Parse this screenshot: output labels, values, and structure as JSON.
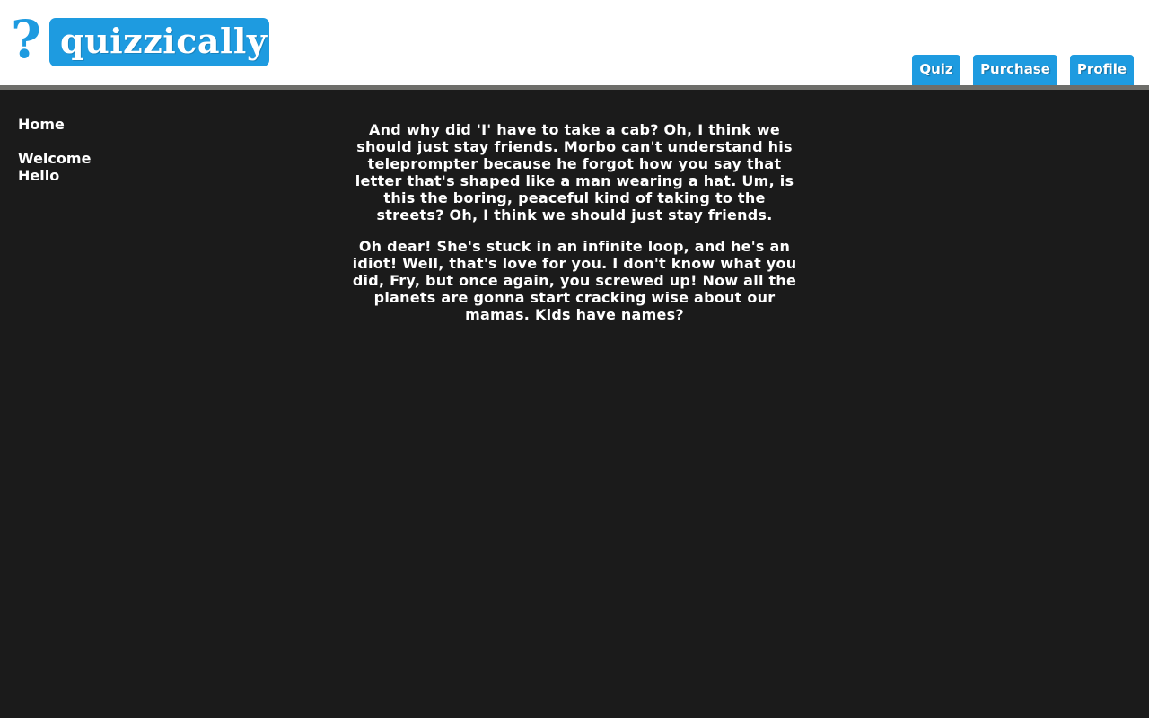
{
  "brand": {
    "mark": "?",
    "name": "quizzically",
    "accent_color": "#1e9be0"
  },
  "nav": {
    "tabs": [
      {
        "label": "Quiz"
      },
      {
        "label": "Purchase"
      },
      {
        "label": "Profile"
      }
    ]
  },
  "sidebar": {
    "items": [
      {
        "label": "Home"
      },
      {
        "label": "Welcome"
      },
      {
        "label": "Hello"
      }
    ]
  },
  "main": {
    "paragraphs": [
      "And why did 'I' have to take a cab? Oh, I think we should just stay friends. Morbo can't understand his teleprompter because he forgot how you say that letter that's shaped like a man wearing a hat. Um, is this the boring, peaceful kind of taking to the streets? Oh, I think we should just stay friends.",
      "Oh dear! She's stuck in an infinite loop, and he's an idiot! Well, that's love for you. I don't know what you did, Fry, but once again, you screwed up! Now all the planets are gonna start cracking wise about our mamas. Kids have names?"
    ]
  },
  "colors": {
    "page_background": "#1b1b1b",
    "header_background": "#ffffff",
    "header_rule": "#6e6e6a",
    "text": "#ffffff"
  }
}
